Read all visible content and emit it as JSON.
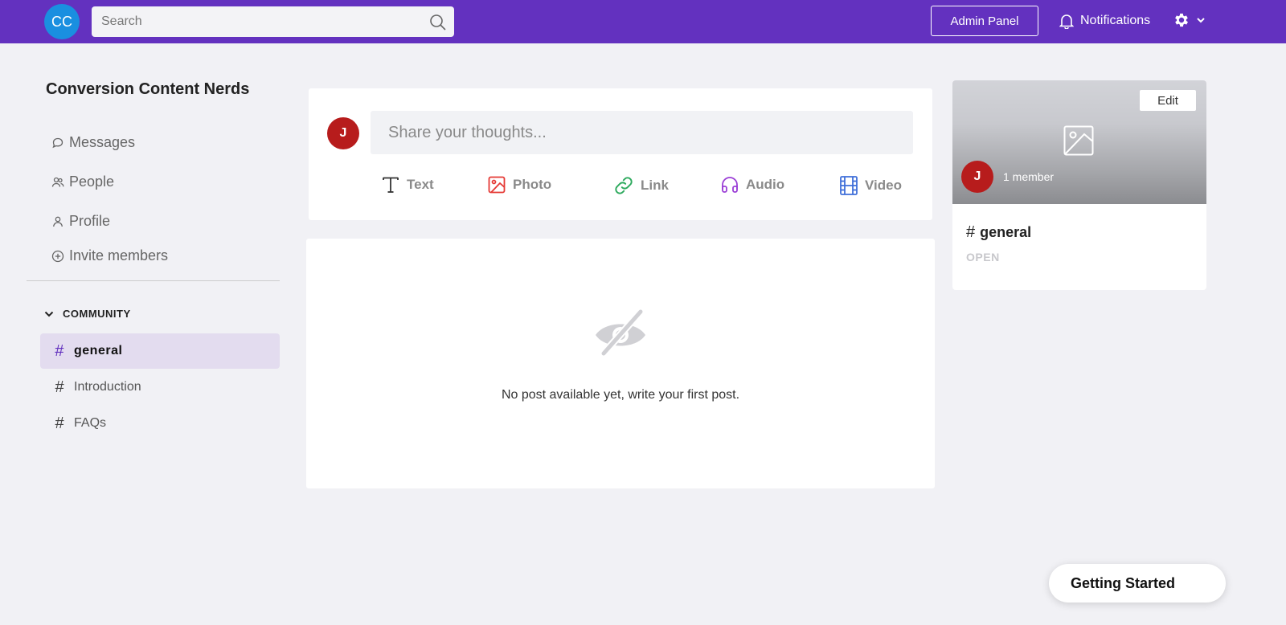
{
  "header": {
    "avatar_initials": "CC",
    "search": {
      "placeholder": "Search",
      "value": ""
    },
    "admin_panel_label": "Admin Panel",
    "notifications_label": "Notifications",
    "colors": {
      "bar": "#6331bf",
      "avatar": "#1a8fe0"
    }
  },
  "sidebar": {
    "community_name": "Conversion Content Nerds",
    "nav": [
      {
        "label": "Messages",
        "icon": "chat-bubble-icon"
      },
      {
        "label": "People",
        "icon": "people-icon"
      },
      {
        "label": "Profile",
        "icon": "person-icon"
      },
      {
        "label": "Invite members",
        "icon": "plus-circle-icon"
      }
    ],
    "section_label": "COMMUNITY",
    "channels": [
      {
        "label": "general",
        "active": true
      },
      {
        "label": "Introduction",
        "active": false
      },
      {
        "label": "FAQs",
        "active": false
      }
    ]
  },
  "composer": {
    "avatar_initial": "J",
    "placeholder": "Share your thoughts...",
    "post_types": [
      {
        "label": "Text",
        "icon": "text-icon",
        "color": "#333333"
      },
      {
        "label": "Photo",
        "icon": "photo-icon",
        "color": "#e53935"
      },
      {
        "label": "Link",
        "icon": "link-icon",
        "color": "#2eaa5e"
      },
      {
        "label": "Audio",
        "icon": "headphones-icon",
        "color": "#9b3fd6"
      },
      {
        "label": "Video",
        "icon": "film-icon",
        "color": "#3f6fd9"
      }
    ]
  },
  "feed": {
    "empty_message": "No post available yet, write your first post."
  },
  "channel_card": {
    "edit_label": "Edit",
    "avatar_initial": "J",
    "member_count": "1 member",
    "channel_name": "general",
    "status": "OPEN"
  },
  "getting_started_label": "Getting Started"
}
